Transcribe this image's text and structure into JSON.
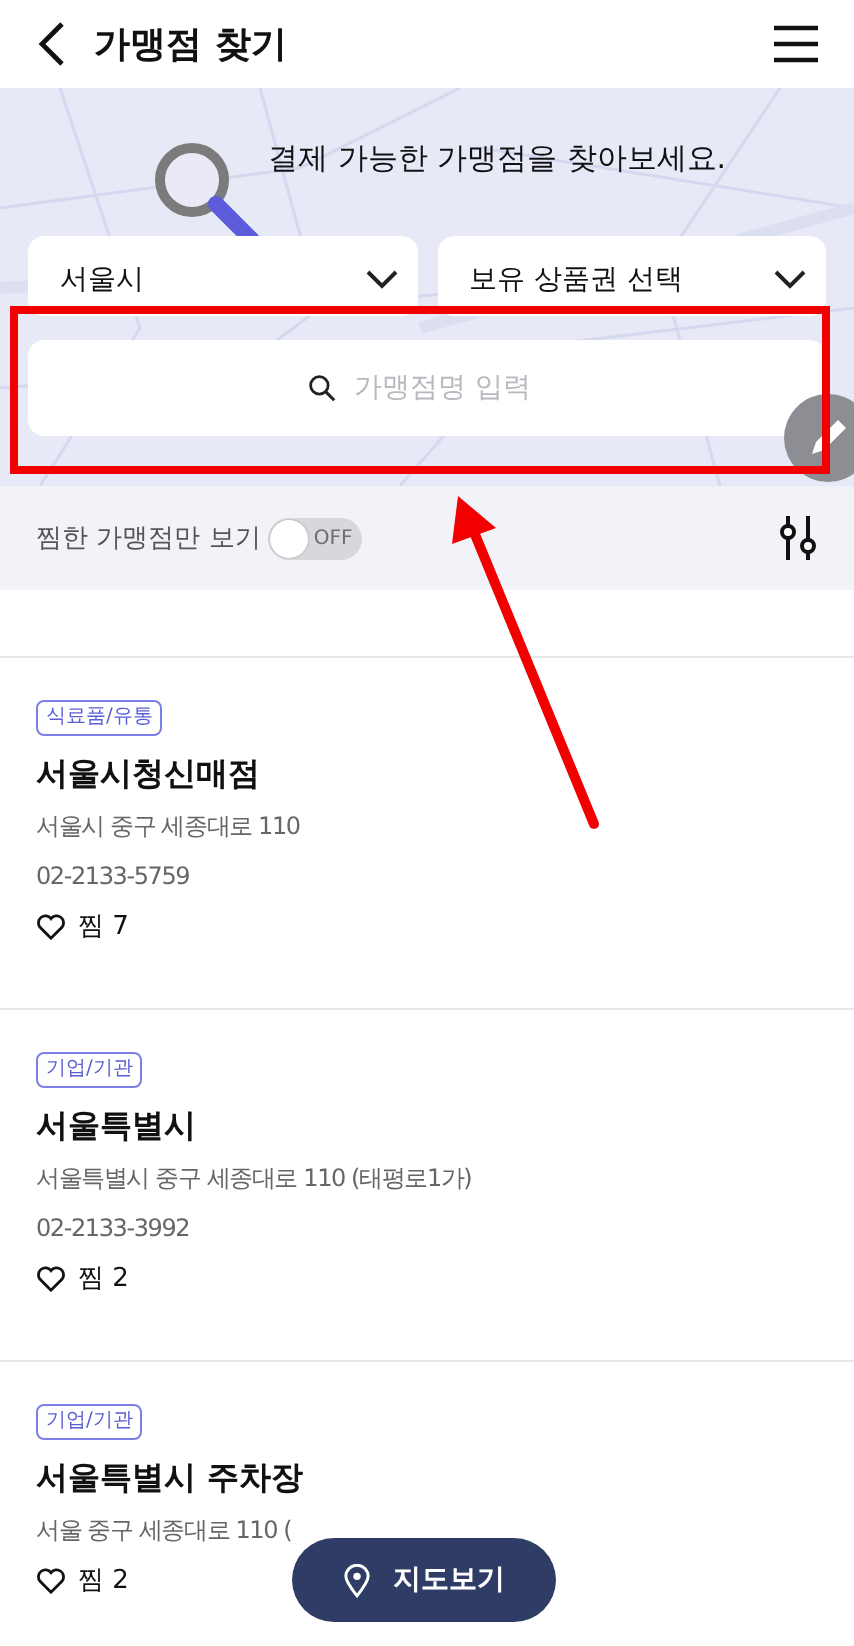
{
  "header": {
    "title": "가맹점 찾기"
  },
  "banner": {
    "message": "결제 가능한 가맹점을 찾아보세요."
  },
  "filters": [
    {
      "value": "서울시"
    },
    {
      "value": "보유 상품권 선택"
    }
  ],
  "search": {
    "placeholder": "가맹점명 입력"
  },
  "favorites_toggle": {
    "label": "찜한 가맹점만 보기",
    "on": false,
    "state_text": "OFF"
  },
  "stores": [
    {
      "tag": "식료품/유통",
      "name": "서울시청신매점",
      "address": "서울시 중구 세종대로 110",
      "phone": "02-2133-5759",
      "likes": "찜 7"
    },
    {
      "tag": "기업/기관",
      "name": "서울특별시",
      "address": "서울특별시 중구 세종대로 110 (태평로1가)",
      "phone": "02-2133-3992",
      "likes": "찜 2"
    },
    {
      "tag": "기업/기관",
      "name": "서울특별시 주차장",
      "address": "서울 중구 세종대로 110 (",
      "likes": "찜 2"
    }
  ],
  "map_button": {
    "label": "지도보기"
  }
}
